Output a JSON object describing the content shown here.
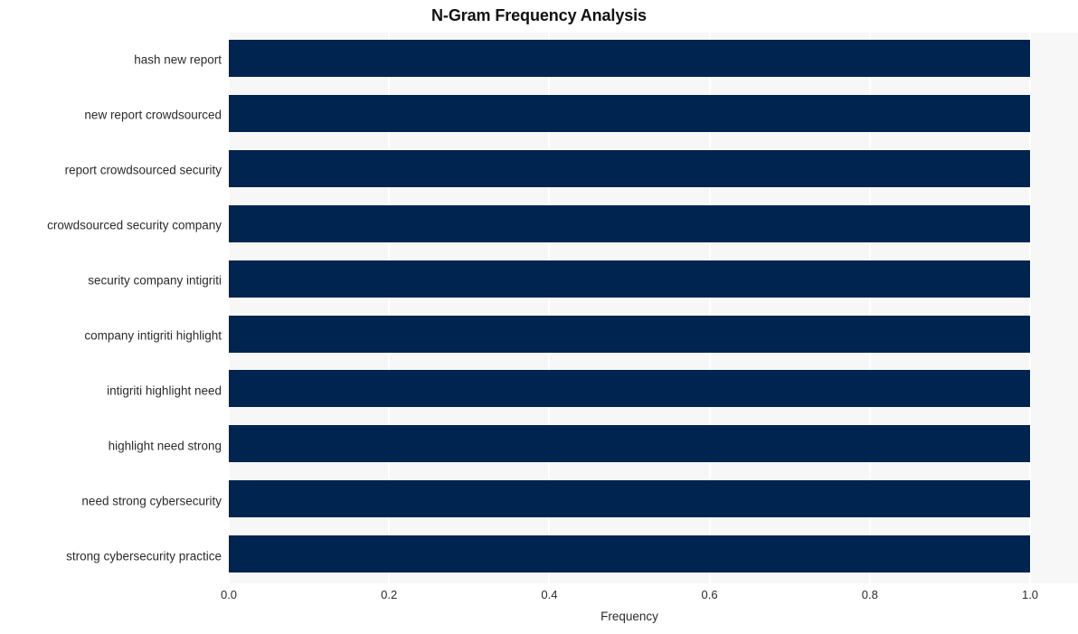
{
  "chart_data": {
    "type": "bar",
    "orientation": "horizontal",
    "title": "N-Gram Frequency Analysis",
    "xlabel": "Frequency",
    "ylabel": "",
    "categories": [
      "hash new report",
      "new report crowdsourced",
      "report crowdsourced security",
      "crowdsourced security company",
      "security company intigriti",
      "company intigriti highlight",
      "intigriti highlight need",
      "highlight need strong",
      "need strong cybersecurity",
      "strong cybersecurity practice"
    ],
    "values": [
      1.0,
      1.0,
      1.0,
      1.0,
      1.0,
      1.0,
      1.0,
      1.0,
      1.0,
      1.0
    ],
    "xlim": [
      0.0,
      1.0
    ],
    "xticks": [
      "0.0",
      "0.2",
      "0.4",
      "0.6",
      "0.8",
      "1.0"
    ],
    "xtick_values": [
      0.0,
      0.2,
      0.4,
      0.6,
      0.8,
      1.0
    ],
    "grid": true,
    "grid_axis": "x",
    "legend": null,
    "bar_color": "#002450",
    "plot_background": "#f7f7f7",
    "figure_background": "#ffffff",
    "gridline_color": "#ffffff",
    "text_color": "#2b2b2b",
    "title_color": "#111111"
  }
}
